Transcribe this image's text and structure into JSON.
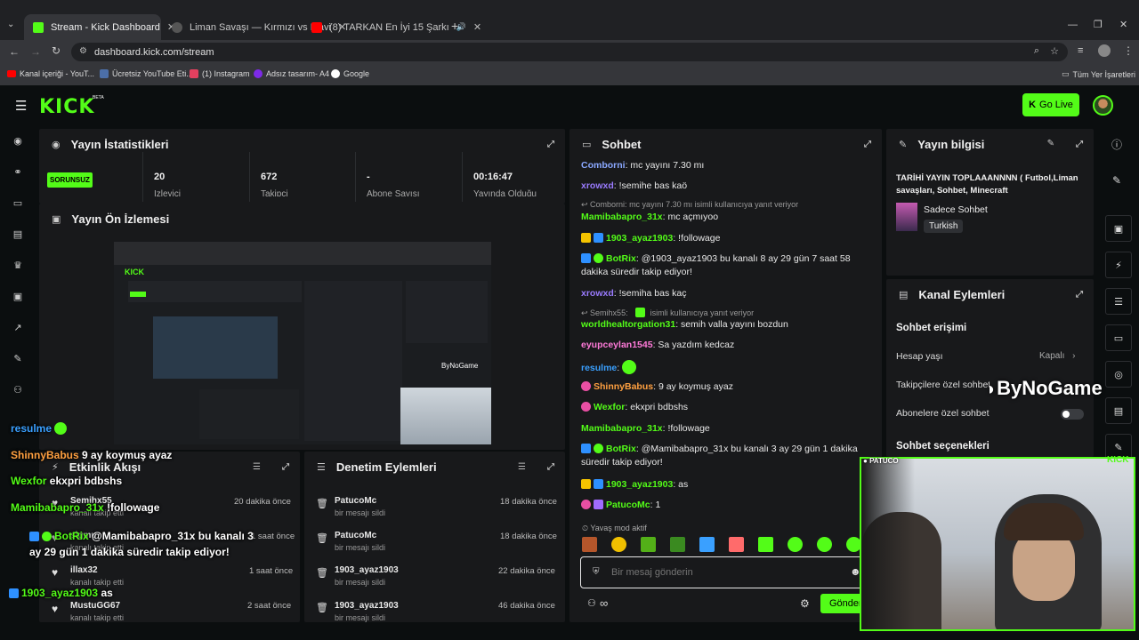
{
  "browser": {
    "tabs": [
      {
        "title": "Stream - Kick Dashboard",
        "active": true
      },
      {
        "title": "Liman Savaşı — Kırmızı vs Mavi"
      },
      {
        "title": "(8) TARKAN En İyi 15 Şarkı"
      }
    ],
    "url": "dashboard.kick.com/stream",
    "bookmarks": [
      "Kanal içeriği - YouT...",
      "Ücretsiz YouTube Eti...",
      "(1) Instagram",
      "Adsız tasarım- A4",
      "Google"
    ],
    "all_bookmarks": "Tüm Yer İşaretleri"
  },
  "kick": {
    "logo": "KICK",
    "beta": "BETA",
    "go_live": "Go Live"
  },
  "stats": {
    "title": "Yayın İstatistikleri",
    "badge": "SORUNSUZ",
    "cells": [
      {
        "value": "20",
        "label": "İzleyici"
      },
      {
        "value": "672",
        "label": "Takipçi"
      },
      {
        "value": "-",
        "label": "Abone Sayısı"
      },
      {
        "value": "00:16:47",
        "label": "Yayında Olduğu"
      }
    ]
  },
  "preview": {
    "title": "Yayın Ön İzlemesi"
  },
  "activity": {
    "title": "Etkinlik Akışı",
    "rows": [
      {
        "name": "Semihx55",
        "sub": "kanalı takip etti",
        "time": "20 dakika önce"
      },
      {
        "name": "sigmu",
        "sub": "kanalı takip etti",
        "time": "1 saat önce"
      },
      {
        "name": "illax32",
        "sub": "kanalı takip etti",
        "time": "1 saat önce"
      },
      {
        "name": "MustuGG67",
        "sub": "kanalı takip etti",
        "time": "2 saat önce"
      }
    ]
  },
  "moderation": {
    "title": "Denetim Eylemleri",
    "rows": [
      {
        "name": "PatucoMc",
        "sub": "bir mesajı sildi",
        "time": "18 dakika önce"
      },
      {
        "name": "PatucoMc",
        "sub": "bir mesajı sildi",
        "time": "18 dakika önce"
      },
      {
        "name": "1903_ayaz1903",
        "sub": "bir mesajı sildi",
        "time": "22 dakika önce"
      },
      {
        "name": "1903_ayaz1903",
        "sub": "bir mesajı sildi",
        "time": "46 dakika önce"
      }
    ]
  },
  "chat": {
    "title": "Sohbet",
    "messages": [
      {
        "user": "Comborni",
        "color": "#8aa8ff",
        "text": "mc yayını 7.30 mı"
      },
      {
        "user": "xrowxd",
        "color": "#9a7bff",
        "text": "!semihe bas kaö"
      },
      {
        "reply": "Comborni: mc yayını 7.30 mı isimli kullanıcıya yanıt veriyor"
      },
      {
        "user": "Mamibabapro_31x",
        "color": "#53fc18",
        "text": "mc açmıyoo"
      },
      {
        "user": "1903_ayaz1903",
        "color": "#53fc18",
        "text": "!followage"
      },
      {
        "user": "BotRix",
        "color": "#53fc18",
        "text": "@1903_ayaz1903 bu kanalı 8 ay 29 gün 7 saat 58 dakika süredir takip ediyor!"
      },
      {
        "user": "xrowxd",
        "color": "#9a7bff",
        "text": "!semiha bas kaç"
      },
      {
        "reply": "Semihx55:",
        "reply_tail": "isimli kullanıcıya yanıt veriyor"
      },
      {
        "user": "worldhealtorgation31",
        "color": "#53fc18",
        "text": "semih valla yayını bozdun"
      },
      {
        "user": "eyupceylan1545",
        "color": "#ff7ad9",
        "text": "Sa yazdım kedcaz"
      },
      {
        "user": "resulme",
        "color": "#3aa0ff",
        "text": ""
      },
      {
        "user": "ShinnyBabus",
        "color": "#ffa040",
        "text": "9 ay koymuş ayaz"
      },
      {
        "user": "Wexfor",
        "color": "#53fc18",
        "text": "ekxpri bdbshs"
      },
      {
        "user": "Mamibabapro_31x",
        "color": "#53fc18",
        "text": "!followage"
      },
      {
        "user": "BotRix",
        "color": "#53fc18",
        "text": "@Mamibabapro_31x bu kanalı 3 ay 29 gün 1 dakika süredir takip ediyor!"
      },
      {
        "user": "1903_ayaz1903",
        "color": "#53fc18",
        "text": "as"
      },
      {
        "user": "PatucoMc",
        "color": "#53fc18",
        "text": "1"
      }
    ],
    "slow_mode": "Yavaş mod aktif",
    "placeholder": "Bir mesaj gönderin",
    "send": "Gönder"
  },
  "info": {
    "title": "Yayın bilgisi",
    "stream_title": "TARİHİ YAYIN TOPLAAANNNN ( Futbol,Liman savaşları, Sohbet, Minecraft",
    "category": "Sadece Sohbet",
    "language": "Turkish"
  },
  "channel_actions": {
    "title": "Kanal Eylemleri",
    "chat_access": "Sohbet erişimi",
    "account_age": "Hesap yaşı",
    "account_age_value": "Kapalı",
    "followers_only": "Takipçilere özel sohbet",
    "subs_only": "Abonelere özel sohbet",
    "chat_options": "Sohbet seçenekleri"
  },
  "overlay": {
    "watermark": "ByNoGame",
    "cam_name": "PATUCO",
    "cam_brand": "KICK",
    "chat": [
      {
        "user": "resulme",
        "color": "#3aa0ff",
        "text": ""
      },
      {
        "user": "ShinnyBabus",
        "color": "#ffa040",
        "text": "9 ay koymuş ayaz"
      },
      {
        "user": "Wexfor",
        "color": "#53fc18",
        "text": "ekxpri bdbshs"
      },
      {
        "user": "Mamibabapro_31x",
        "color": "#53fc18",
        "text": "!followage"
      },
      {
        "user": "BotRix",
        "color": "#53fc18",
        "text": "@Mamibabapro_31x bu kanalı 3 ay 29 gün 1 dakika süredir takip ediyor!"
      },
      {
        "user": "1903_ayaz1903",
        "color": "#53fc18",
        "text": "as"
      }
    ]
  },
  "colors": {
    "accent": "#53fc18",
    "panel": "#18191b",
    "bg": "#0b0e0f"
  }
}
